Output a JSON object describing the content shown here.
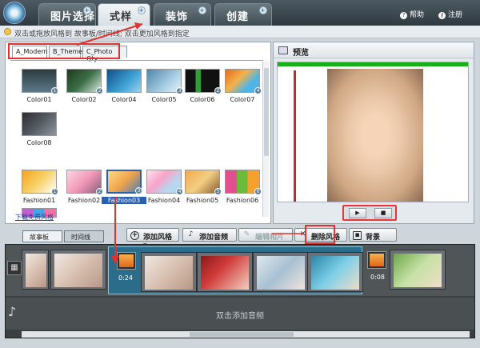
{
  "main_tabs": [
    {
      "label": "图片选择"
    },
    {
      "label": "式样"
    },
    {
      "label": "装饰"
    },
    {
      "label": "创建"
    }
  ],
  "top_links": {
    "help": "帮助",
    "register": "注册"
  },
  "hint": "双击或拖放风格到 故事板/时间线; 双击更加风格到指定",
  "style_tabs": [
    "A_Modern",
    "B_Theme",
    "C_Photo Qty"
  ],
  "row1": [
    "Color01",
    "Color02",
    "Color04",
    "Color05",
    "Color06",
    "Color07"
  ],
  "row2": [
    "Color08"
  ],
  "row3": [
    "Fashion01",
    "Fashion02",
    "Fashion03",
    "Fashion04",
    "Fashion05",
    "Fashion06"
  ],
  "download_link": "下载免费风格",
  "preview_title": "预览",
  "toolbar": {
    "add_style": "添加风格",
    "add_audio": "添加音频",
    "edit_photo": "编辑相片",
    "delete_style": "删除风格",
    "background": "背景"
  },
  "view_tabs": [
    "故事板",
    "时间线"
  ],
  "timeline": {
    "time1": "0:24",
    "time2": "0:08"
  },
  "audio_hint": "双击添加音频",
  "colors": {
    "accent": "#2a6c8a",
    "highlight": "#e53030"
  }
}
